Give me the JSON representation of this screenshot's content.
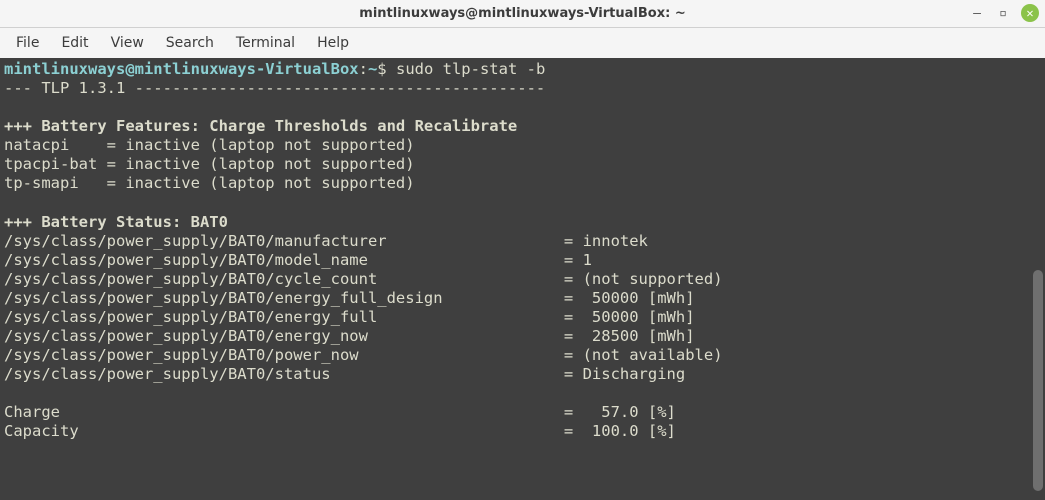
{
  "window": {
    "title": "mintlinuxways@mintlinuxways-VirtualBox: ~"
  },
  "menubar": {
    "items": [
      "File",
      "Edit",
      "View",
      "Search",
      "Terminal",
      "Help"
    ]
  },
  "prompt": {
    "userhost": "mintlinuxways@mintlinuxways-VirtualBox",
    "sep1": ":",
    "path": "~",
    "sigil": "$",
    "command": "sudo tlp-stat -b"
  },
  "output": {
    "header": "--- TLP 1.3.1 --------------------------------------------",
    "blank1": "",
    "features_title": "+++ Battery Features: Charge Thresholds and Recalibrate",
    "natacpi": "natacpi    = inactive (laptop not supported)",
    "tpacpi": "tpacpi-bat = inactive (laptop not supported)",
    "tpsmapi": "tp-smapi   = inactive (laptop not supported)",
    "blank2": "",
    "status_title": "+++ Battery Status: BAT0",
    "manufacturer": "/sys/class/power_supply/BAT0/manufacturer                   = innotek",
    "model_name": "/sys/class/power_supply/BAT0/model_name                     = 1",
    "cycle_count": "/sys/class/power_supply/BAT0/cycle_count                    = (not supported)",
    "energy_full_design": "/sys/class/power_supply/BAT0/energy_full_design             =  50000 [mWh]",
    "energy_full": "/sys/class/power_supply/BAT0/energy_full                    =  50000 [mWh]",
    "energy_now": "/sys/class/power_supply/BAT0/energy_now                     =  28500 [mWh]",
    "power_now": "/sys/class/power_supply/BAT0/power_now                      = (not available)",
    "status": "/sys/class/power_supply/BAT0/status                         = Discharging",
    "blank3": "",
    "charge": "Charge                                                      =   57.0 [%]",
    "capacity": "Capacity                                                    =  100.0 [%]"
  }
}
